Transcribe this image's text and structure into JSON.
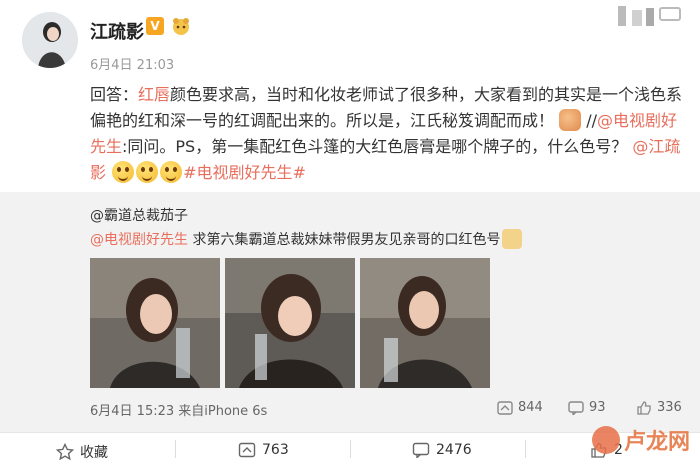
{
  "post": {
    "author": "江疏影",
    "verified_badge": "V",
    "time": "6月4日 21:03",
    "text_parts": {
      "p1": "回答：",
      "p2": "红唇",
      "p3": "颜色要求高，当时和化妆老师试了很多种，大家看到的其实是一个浅色系偏艳的红和深一号的红调配出来的。所以是，江氏秘笈调配而成！",
      "p4": " //",
      "p5": "@电视剧好先生",
      "p6": ":同问。PS，第一集配红色斗篷的大红色唇膏是哪个牌子的，什么色号？",
      "p7": "@江疏影",
      "p8": "#电视剧好先生#"
    }
  },
  "quoted": {
    "author": "@霸道总裁茄子",
    "mention": "@电视剧好先生",
    "text": " 求第六集霸道总裁妹妹带假男友见亲哥的口红色号",
    "meta": "6月4日 15:23 来自iPhone 6s",
    "reposts": "844",
    "comments": "93",
    "likes": "336"
  },
  "actions": {
    "favorite": "收藏",
    "repost": "763",
    "comment": "2476",
    "like": "2"
  },
  "watermark": "卢龙网",
  "colors": {
    "accent": "#e86f5d",
    "quote_bg": "#f2f2f2",
    "vip": "#f6a623"
  },
  "icons": [
    "star-icon",
    "repost-icon",
    "comment-icon",
    "like-icon",
    "status-icons"
  ]
}
